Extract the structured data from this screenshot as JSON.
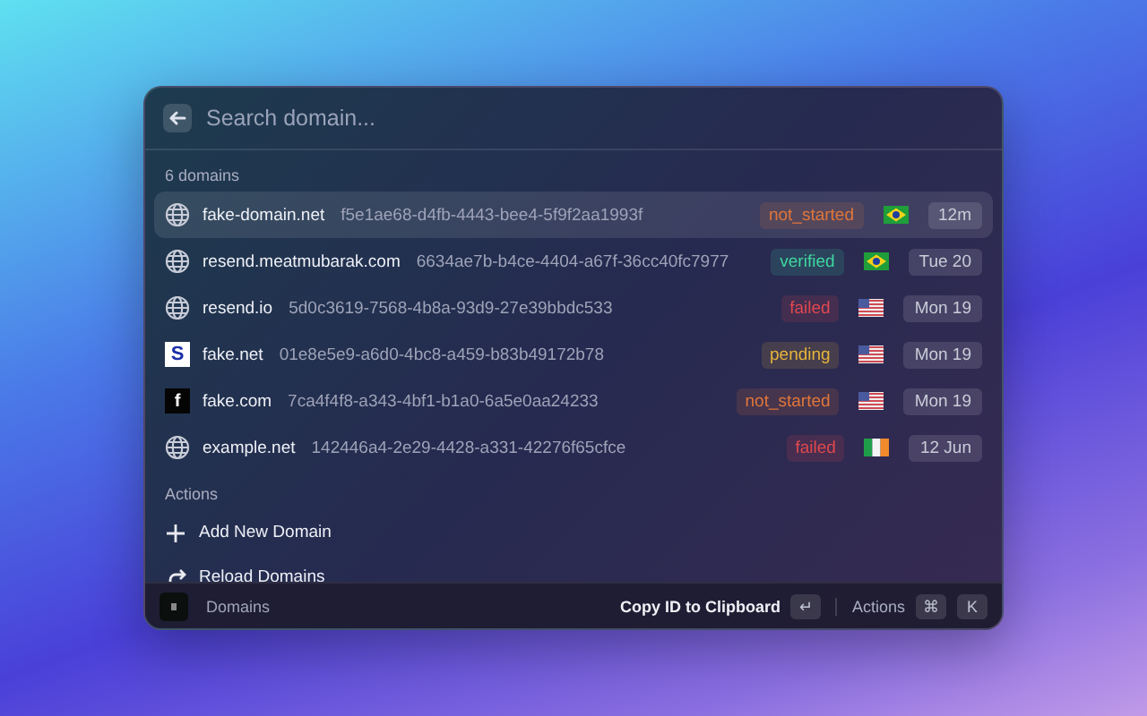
{
  "search": {
    "placeholder": "Search domain..."
  },
  "section_title": "6 domains",
  "domains": [
    {
      "icon": {
        "kind": "globe"
      },
      "name": "fake-domain.net",
      "id": "f5e1ae68-d4fb-4443-bee4-5f9f2aa1993f",
      "status": "not_started",
      "color": "#e0763a",
      "flag": {
        "kind": "br"
      },
      "date": "12m",
      "selected": true
    },
    {
      "icon": {
        "kind": "globe"
      },
      "name": "resend.meatmubarak.com",
      "id": "6634ae7b-b4ce-4404-a67f-36cc40fc7977",
      "status": "verified",
      "color": "#3fd6a0",
      "flag": {
        "kind": "br"
      },
      "date": "Tue 20",
      "selected": false
    },
    {
      "icon": {
        "kind": "globe"
      },
      "name": "resend.io",
      "id": "5d0c3619-7568-4b8a-93d9-27e39bbdc533",
      "status": "failed",
      "color": "#e0484f",
      "flag": {
        "kind": "us"
      },
      "date": "Mon 19",
      "selected": false
    },
    {
      "icon": {
        "kind": "light",
        "letter": "S"
      },
      "name": "fake.net",
      "id": "01e8e5e9-a6d0-4bc8-a459-b83b49172b78",
      "status": "pending",
      "color": "#e6b43a",
      "flag": {
        "kind": "us"
      },
      "date": "Mon 19",
      "selected": false
    },
    {
      "icon": {
        "kind": "dark",
        "letter": "f"
      },
      "name": "fake.com",
      "id": "7ca4f4f8-a343-4bf1-b1a0-6a5e0aa24233",
      "status": "not_started",
      "color": "#e0763a",
      "flag": {
        "kind": "us"
      },
      "date": "Mon 19",
      "selected": false
    },
    {
      "icon": {
        "kind": "globe"
      },
      "name": "example.net",
      "id": "142446a4-2e29-4428-a331-42276f65cfce",
      "status": "failed",
      "color": "#e0484f",
      "flag": {
        "kind": "ie"
      },
      "date": "12 Jun",
      "selected": false
    }
  ],
  "actions_title": "Actions",
  "actions": [
    {
      "kind": "plus",
      "label": "Add New Domain"
    },
    {
      "kind": "reload",
      "label": "Reload Domains"
    }
  ],
  "footer": {
    "title": "Domains",
    "primary": "Copy ID to Clipboard",
    "primary_key": "↵",
    "secondary": "Actions",
    "secondary_keys": [
      "⌘",
      "K"
    ]
  }
}
